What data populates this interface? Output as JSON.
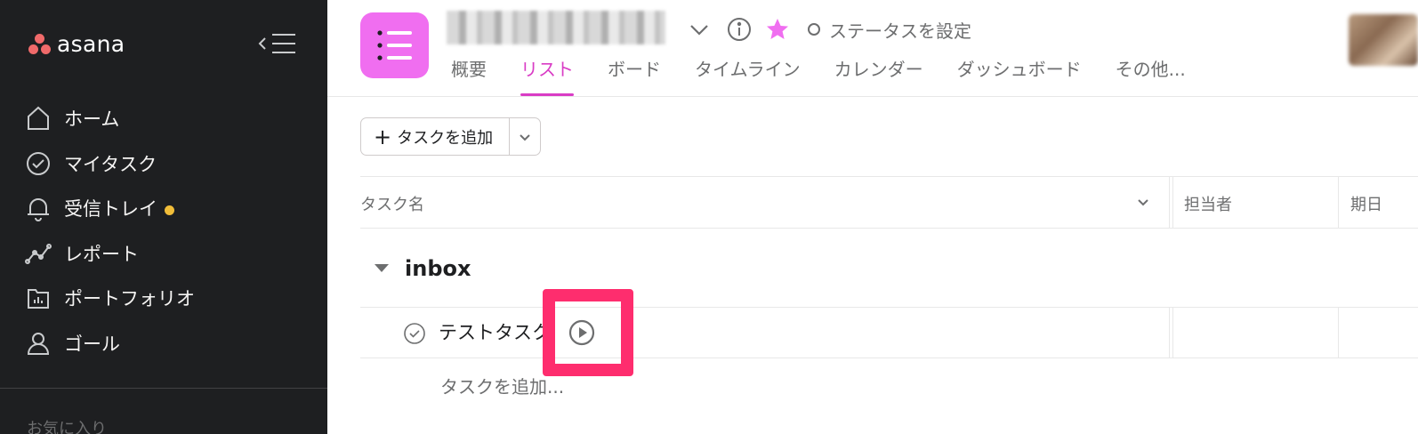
{
  "sidebar": {
    "brand": "asana",
    "nav": [
      {
        "label": "ホーム",
        "icon": "home-icon"
      },
      {
        "label": "マイタスク",
        "icon": "check-circle-icon"
      },
      {
        "label": "受信トレイ",
        "icon": "bell-icon",
        "badge_color": "#f1bd39"
      },
      {
        "label": "レポート",
        "icon": "reporting-icon"
      },
      {
        "label": "ポートフォリオ",
        "icon": "portfolio-icon"
      },
      {
        "label": "ゴール",
        "icon": "goal-icon"
      }
    ],
    "favorites_label": "お気に入り"
  },
  "header": {
    "status_label": "ステータスを設定",
    "tabs": [
      {
        "label": "概要",
        "active": false
      },
      {
        "label": "リスト",
        "active": true
      },
      {
        "label": "ボード",
        "active": false
      },
      {
        "label": "タイムライン",
        "active": false
      },
      {
        "label": "カレンダー",
        "active": false
      },
      {
        "label": "ダッシュボード",
        "active": false
      },
      {
        "label": "その他...",
        "active": false
      }
    ],
    "accent_color": "#d93cc5",
    "project_icon_color": "#f06ef0"
  },
  "toolbar": {
    "add_task_label": "タスクを追加"
  },
  "table": {
    "columns": [
      "タスク名",
      "担当者",
      "期日"
    ],
    "section": "inbox",
    "tasks": [
      {
        "name": "テストタスク"
      }
    ],
    "add_task_link": "タスクを追加..."
  },
  "annotation": {
    "highlight_color": "#fe2d6e",
    "target": "task-details-icon"
  }
}
